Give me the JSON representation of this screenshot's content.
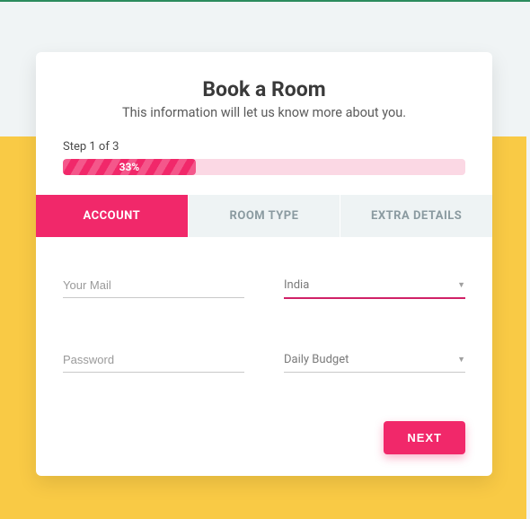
{
  "header": {
    "title": "Book a Room",
    "subtitle": "This information will let us know more about you."
  },
  "progress": {
    "step_label": "Step 1 of 3",
    "percent_label": "33%",
    "percent": 33
  },
  "tabs": [
    {
      "label": "ACCOUNT",
      "active": true
    },
    {
      "label": "ROOM TYPE",
      "active": false
    },
    {
      "label": "EXTRA DETAILS",
      "active": false
    }
  ],
  "form": {
    "email": {
      "placeholder": "Your Mail",
      "value": ""
    },
    "country": {
      "selected": "India"
    },
    "password": {
      "placeholder": "Password",
      "value": ""
    },
    "budget": {
      "selected": "Daily Budget"
    }
  },
  "actions": {
    "next_label": "NEXT"
  },
  "colors": {
    "accent": "#f1286a",
    "band": "#f9ca45",
    "tab_bg": "#eef3f4"
  }
}
